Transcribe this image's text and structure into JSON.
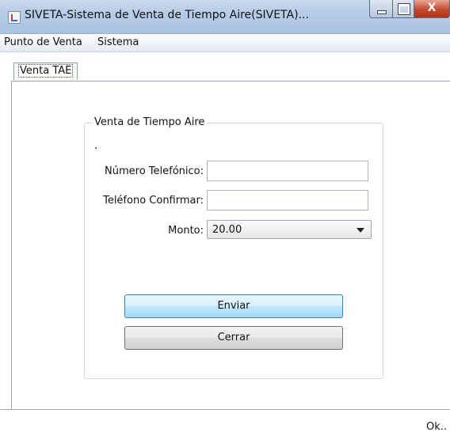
{
  "window": {
    "title": "SIVETA-Sistema de Venta de Tiempo Aire(SIVETA)...",
    "close_glyph": "X"
  },
  "menubar": {
    "items": [
      "Punto de Venta",
      "Sistema"
    ]
  },
  "tabs": [
    {
      "label": "Venta TAE",
      "selected": true
    }
  ],
  "form": {
    "group_title": "Venta de Tiempo Aire",
    "note": ".",
    "phone_label": "Número Telefónico:",
    "phone_value": "",
    "confirm_label": "Teléfono Confirmar:",
    "confirm_value": "",
    "amount_label": "Monto:",
    "amount_value": "20.00"
  },
  "buttons": {
    "send": "Enviar",
    "close": "Cerrar"
  },
  "status": {
    "text": "Ok.."
  },
  "colors": {
    "primary_button_border": "#3c7fb1",
    "titlebar": "#b5cbe6"
  }
}
